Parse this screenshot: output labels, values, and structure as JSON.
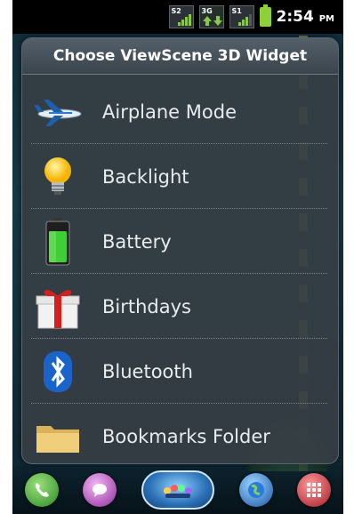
{
  "status_bar": {
    "signals": [
      {
        "label": "S2"
      },
      {
        "label": "3G"
      },
      {
        "label": "S1"
      }
    ],
    "time": "2:54",
    "ampm": "PM"
  },
  "dialog": {
    "title": "Choose ViewScene 3D Widget",
    "items": [
      {
        "label": "Airplane Mode",
        "icon": "airplane-icon"
      },
      {
        "label": "Backlight",
        "icon": "lightbulb-icon"
      },
      {
        "label": "Battery",
        "icon": "battery-icon"
      },
      {
        "label": "Birthdays",
        "icon": "gift-icon"
      },
      {
        "label": "Bluetooth",
        "icon": "bluetooth-icon"
      },
      {
        "label": "Bookmarks Folder",
        "icon": "folder-icon"
      }
    ]
  },
  "dock": {
    "buttons": [
      "phone-icon",
      "messaging-icon",
      "apps-icon",
      "browser-icon",
      "menu-grid-icon"
    ]
  },
  "colors": {
    "dialog_bg": "#363e44",
    "text": "#e8ecee",
    "accent_green": "#8fcf3a"
  }
}
